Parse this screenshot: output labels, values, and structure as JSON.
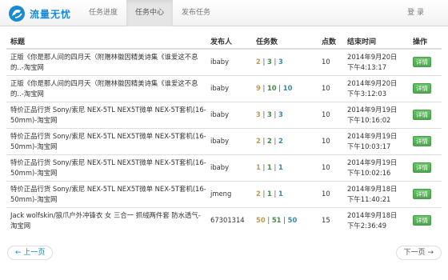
{
  "brand": {
    "name": "流量无忧"
  },
  "nav": {
    "items": [
      "任务进度",
      "任务中心",
      "发布任务"
    ],
    "active": 1
  },
  "login_label": "登 录",
  "table": {
    "headers": {
      "title": "标题",
      "publisher": "发布人",
      "count": "任务数",
      "points": "点数",
      "end": "结束时间",
      "action": "操作"
    },
    "rows": [
      {
        "title": "正版《你是那人间的四月天（附赠林徽因精美诗集《谁爱这不息的..-淘宝网",
        "publisher": "ibaby",
        "c1": "2",
        "c2": "3",
        "c3": "3",
        "points": "10",
        "end_date": "2014年9月20日",
        "end_time": "下午4:13:17",
        "action": "详情"
      },
      {
        "title": "正版《你是那人间的四月天（附赠林徽因精美诗集《谁爱这不息的..-淘宝网",
        "publisher": "ibaby",
        "c1": "9",
        "c2": "10",
        "c3": "10",
        "points": "10",
        "end_date": "2014年9月20日",
        "end_time": "下午3:12:03",
        "action": "详情"
      },
      {
        "title": "特价正品行货 Sony/索尼 NEX-5TL NEX5T微单 NEX-5T套机(16-50mm)-淘宝网",
        "publisher": "ibaby",
        "c1": "3",
        "c2": "3",
        "c3": "3",
        "points": "10",
        "end_date": "2014年9月19日",
        "end_time": "下午10:16:02",
        "action": "详情"
      },
      {
        "title": "特价正品行货 Sony/索尼 NEX-5TL NEX5T微单 NEX-5T套机(16-50mm)-淘宝网",
        "publisher": "ibaby",
        "c1": "2",
        "c2": "2",
        "c3": "2",
        "points": "10",
        "end_date": "2014年9月19日",
        "end_time": "下午10:03:17",
        "action": "详情"
      },
      {
        "title": "特价正品行货 Sony/索尼 NEX-5TL NEX5T微单 NEX-5T套机(16-50mm)-淘宝网",
        "publisher": "ibaby",
        "c1": "1",
        "c2": "1",
        "c3": "1",
        "points": "10",
        "end_date": "2014年9月19日",
        "end_time": "下午10:02:16",
        "action": "详情"
      },
      {
        "title": "特价正品行货 Sony/索尼 NEX-5TL NEX5T微单 NEX-5T套机(16-50mm)-淘宝网",
        "publisher": "jmeng",
        "c1": "2",
        "c2": "1",
        "c3": "1",
        "points": "10",
        "end_date": "2014年9月18日",
        "end_time": "下午11:40:21",
        "action": "详情"
      },
      {
        "title": "Jack wolfskin/狼爪户外冲锋衣 女 三合一 抓绒两件套 防水透气-淘宝网",
        "publisher": "67301314",
        "c1": "50",
        "c2": "51",
        "c3": "50",
        "points": "15",
        "end_date": "2014年9月18日",
        "end_time": "下午2:36:49",
        "action": "详情"
      }
    ]
  },
  "pager": {
    "prev": "← 上一页",
    "next": "下一页 →"
  },
  "colors": {
    "brand": "#1a8ad3",
    "count_a": "#c09853",
    "count_b": "#468847",
    "count_c": "#3a87ad",
    "button": "#5bb75b"
  }
}
